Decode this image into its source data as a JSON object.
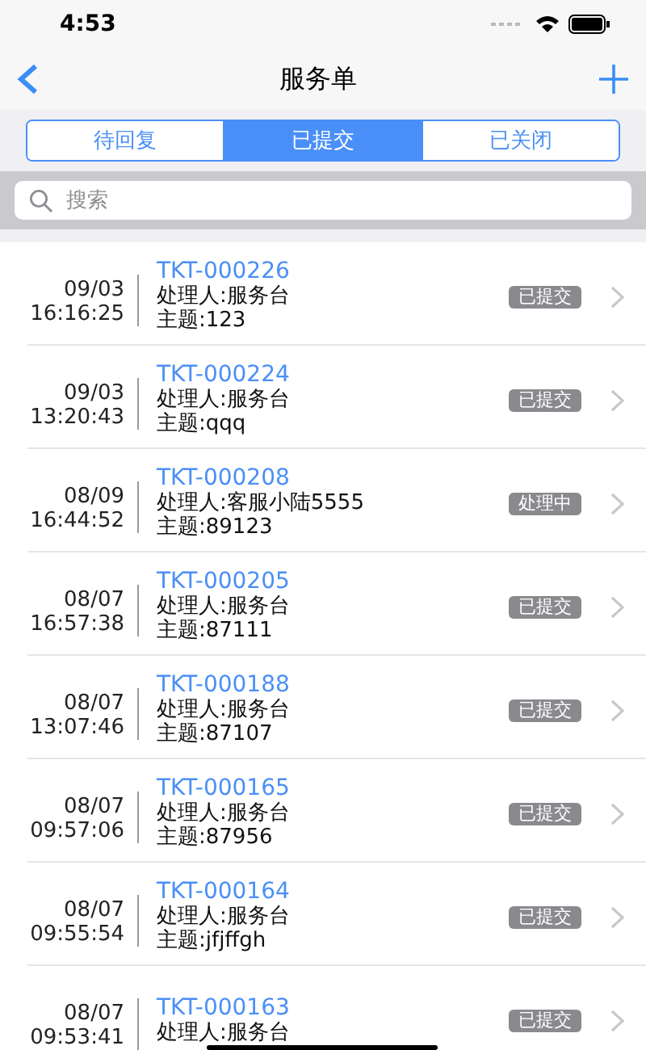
{
  "status_bar": {
    "time": "4:53"
  },
  "nav": {
    "title": "服务单"
  },
  "tabs": [
    {
      "label": "待回复",
      "selected": false
    },
    {
      "label": "已提交",
      "selected": true
    },
    {
      "label": "已关闭",
      "selected": false
    }
  ],
  "search": {
    "placeholder": "搜索"
  },
  "tickets": [
    {
      "date": "09/03",
      "time": "16:16:25",
      "id": "TKT-000226",
      "handler": "处理人:服务台",
      "subject": "主题:123",
      "status": "已提交"
    },
    {
      "date": "09/03",
      "time": "13:20:43",
      "id": "TKT-000224",
      "handler": "处理人:服务台",
      "subject": "主题:qqq",
      "status": "已提交"
    },
    {
      "date": "08/09",
      "time": "16:44:52",
      "id": "TKT-000208",
      "handler": "处理人:客服小陆5555",
      "subject": "主题:89123",
      "status": "处理中"
    },
    {
      "date": "08/07",
      "time": "16:57:38",
      "id": "TKT-000205",
      "handler": "处理人:服务台",
      "subject": "主题:87111",
      "status": "已提交"
    },
    {
      "date": "08/07",
      "time": "13:07:46",
      "id": "TKT-000188",
      "handler": "处理人:服务台",
      "subject": "主题:87107",
      "status": "已提交"
    },
    {
      "date": "08/07",
      "time": "09:57:06",
      "id": "TKT-000165",
      "handler": "处理人:服务台",
      "subject": "主题:87956",
      "status": "已提交"
    },
    {
      "date": "08/07",
      "time": "09:55:54",
      "id": "TKT-000164",
      "handler": "处理人:服务台",
      "subject": "主题:jfjffgh",
      "status": "已提交"
    },
    {
      "date": "08/07",
      "time": "09:53:41",
      "id": "TKT-000163",
      "handler": "处理人:服务台",
      "status": "已提交"
    }
  ]
}
